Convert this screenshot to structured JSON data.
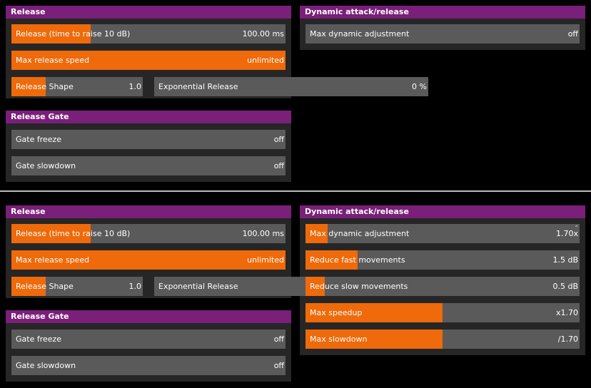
{
  "top": {
    "release": {
      "title": "Release",
      "time_label": "Release (time to raise 10 dB)",
      "time_value": "100.00 ms",
      "time_fill": 0.29,
      "speed_label": "Max release speed",
      "speed_value": "unlimited",
      "speed_fill": 1.0,
      "shape_label": "Release Shape",
      "shape_value": "1.0",
      "shape_fill": 0.26,
      "exp_label": "Exponential Release",
      "exp_value": "0 %",
      "exp_fill": 0.0
    },
    "gate": {
      "title": "Release Gate",
      "freeze_label": "Gate freeze",
      "freeze_value": "off",
      "slowdown_label": "Gate slowdown",
      "slowdown_value": "off"
    },
    "dynamic": {
      "title": "Dynamic attack/release",
      "adj_label": "Max dynamic adjustment",
      "adj_value": "off",
      "adj_fill": 0.0
    }
  },
  "bottom": {
    "release": {
      "title": "Release",
      "time_label": "Release (time to raise 10 dB)",
      "time_value": "100.00 ms",
      "time_fill": 0.29,
      "speed_label": "Max release speed",
      "speed_value": "unlimited",
      "speed_fill": 1.0,
      "shape_label": "Release Shape",
      "shape_value": "1.0",
      "shape_fill": 0.26,
      "exp_label": "Exponential Release",
      "exp_fill": 0.0
    },
    "gate": {
      "title": "Release Gate",
      "freeze_label": "Gate freeze",
      "freeze_value": "off",
      "slowdown_label": "Gate slowdown",
      "slowdown_value": "off"
    },
    "dynamic": {
      "title": "Dynamic attack/release",
      "adj_label": "Max dynamic adjustment",
      "adj_value": "1.70x",
      "adj_fill": 0.08,
      "fast_label": "Reduce fast movements",
      "fast_value": "1.5 dB",
      "fast_fill": 0.19,
      "slow_label": "Reduce slow movements",
      "slow_value": "0.5 dB",
      "slow_fill": 0.07,
      "speedup_label": "Max speedup",
      "speedup_value": "x1.70",
      "speedup_fill": 0.5,
      "slowdown_label": "Max slowdown",
      "slowdown_value": "/1.70",
      "slowdown_fill": 0.5
    }
  },
  "colors": {
    "accent": "#ee6a0a",
    "header": "#7a1f7a",
    "track": "#5a5a5a",
    "panel": "#262626"
  }
}
